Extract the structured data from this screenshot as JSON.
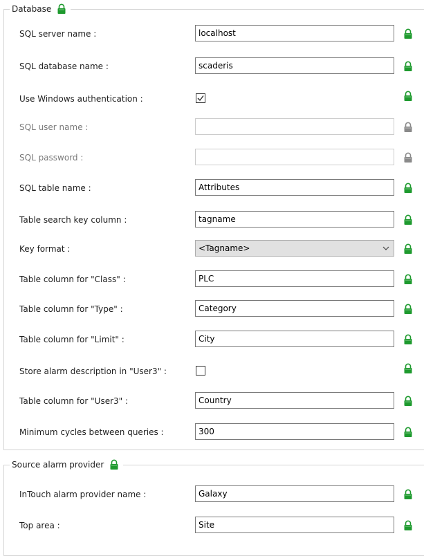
{
  "database": {
    "title": "Database",
    "fields": [
      {
        "label": "SQL server name :",
        "value": "localhost",
        "kind": "text",
        "disabled": false,
        "lock": "green"
      },
      {
        "label": "SQL database name :",
        "value": "scaderis",
        "kind": "text",
        "disabled": false,
        "lock": "green"
      },
      {
        "label": "Use Windows authentication :",
        "checked": true,
        "kind": "checkbox",
        "disabled": false,
        "lock": "green"
      },
      {
        "label": "SQL user name :",
        "value": "",
        "kind": "text",
        "disabled": true,
        "lock": "gray"
      },
      {
        "label": "SQL password :",
        "value": "",
        "kind": "text",
        "disabled": true,
        "lock": "gray"
      },
      {
        "label": "SQL table name :",
        "value": "Attributes",
        "kind": "text",
        "disabled": false,
        "lock": "green"
      },
      {
        "label": "Table search key column :",
        "value": "tagname",
        "kind": "text",
        "disabled": false,
        "lock": "green"
      },
      {
        "label": "Key format :",
        "value": "<Tagname>",
        "kind": "select",
        "disabled": false,
        "lock": "green"
      },
      {
        "label": "Table column for \"Class\" :",
        "value": "PLC",
        "kind": "text",
        "disabled": false,
        "lock": "green"
      },
      {
        "label": "Table column for \"Type\" :",
        "value": "Category",
        "kind": "text",
        "disabled": false,
        "lock": "green"
      },
      {
        "label": "Table column for \"Limit\" :",
        "value": "City",
        "kind": "text",
        "disabled": false,
        "lock": "green"
      },
      {
        "label": "Store alarm description in \"User3\" :",
        "checked": false,
        "kind": "checkbox",
        "disabled": false,
        "lock": "green"
      },
      {
        "label": "Table column for \"User3\" :",
        "value": "Country",
        "kind": "text",
        "disabled": false,
        "lock": "green"
      },
      {
        "label": "Minimum cycles between queries :",
        "value": "300",
        "kind": "text",
        "disabled": false,
        "lock": "green"
      }
    ]
  },
  "source": {
    "title": "Source alarm provider",
    "fields": [
      {
        "label": "InTouch alarm provider name :",
        "value": "Galaxy",
        "kind": "text",
        "disabled": false,
        "lock": "green"
      },
      {
        "label": "Top area :",
        "value": "Site",
        "kind": "text",
        "disabled": false,
        "lock": "green"
      }
    ]
  },
  "icons": {
    "lock": "lock-icon",
    "chevron": "chevron-down-icon",
    "check": "checkmark-icon"
  },
  "colors": {
    "lock_green": "#1e9a2e",
    "lock_gray": "#8a8a8a",
    "border": "#7a7a7a",
    "disabled_text": "#7a7a7a"
  }
}
